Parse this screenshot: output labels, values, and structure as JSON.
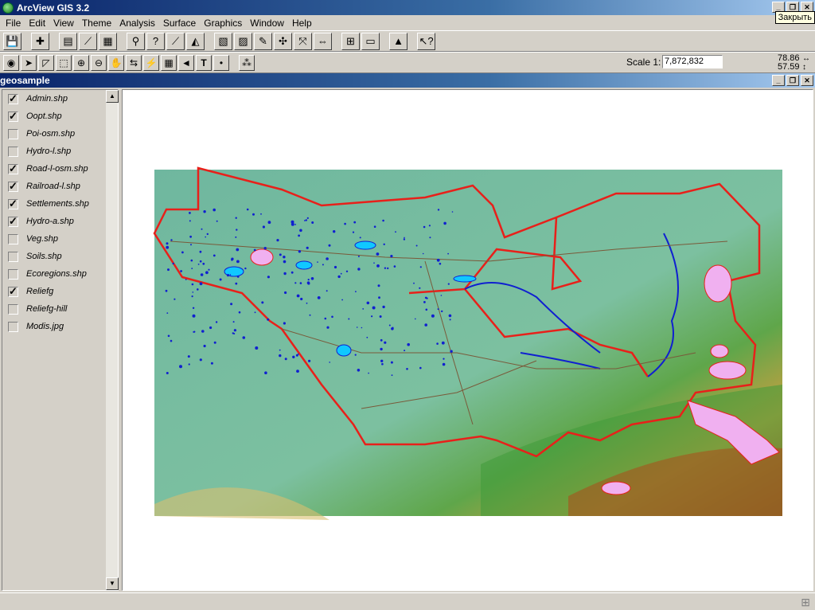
{
  "app": {
    "title": "ArcView GIS 3.2",
    "tooltip": "Закрыть"
  },
  "menu": [
    "File",
    "Edit",
    "View",
    "Theme",
    "Analysis",
    "Surface",
    "Graphics",
    "Window",
    "Help"
  ],
  "toolbar": {
    "scale_label": "Scale 1:",
    "scale_value": "7,872,832",
    "coord_x": "78.86",
    "coord_y": "57.59"
  },
  "document": {
    "title": "geosample"
  },
  "layers": [
    {
      "name": "Admin.shp",
      "checked": true
    },
    {
      "name": "Oopt.shp",
      "checked": true
    },
    {
      "name": "Poi-osm.shp",
      "checked": false
    },
    {
      "name": "Hydro-l.shp",
      "checked": false
    },
    {
      "name": "Road-l-osm.shp",
      "checked": true
    },
    {
      "name": "Railroad-l.shp",
      "checked": true
    },
    {
      "name": "Settlements.shp",
      "checked": true
    },
    {
      "name": "Hydro-a.shp",
      "checked": true
    },
    {
      "name": "Veg.shp",
      "checked": false
    },
    {
      "name": "Soils.shp",
      "checked": false
    },
    {
      "name": "Ecoregions.shp",
      "checked": false
    },
    {
      "name": "Reliefg",
      "checked": true
    },
    {
      "name": "Reliefg-hill",
      "checked": false
    },
    {
      "name": "Modis.jpg",
      "checked": false
    }
  ],
  "colors": {
    "boundary": "#e8201a",
    "relief_low": "#6fb79f",
    "relief_high": "#b0401a",
    "water": "#1020d0",
    "protected": "#f0b0f0"
  }
}
